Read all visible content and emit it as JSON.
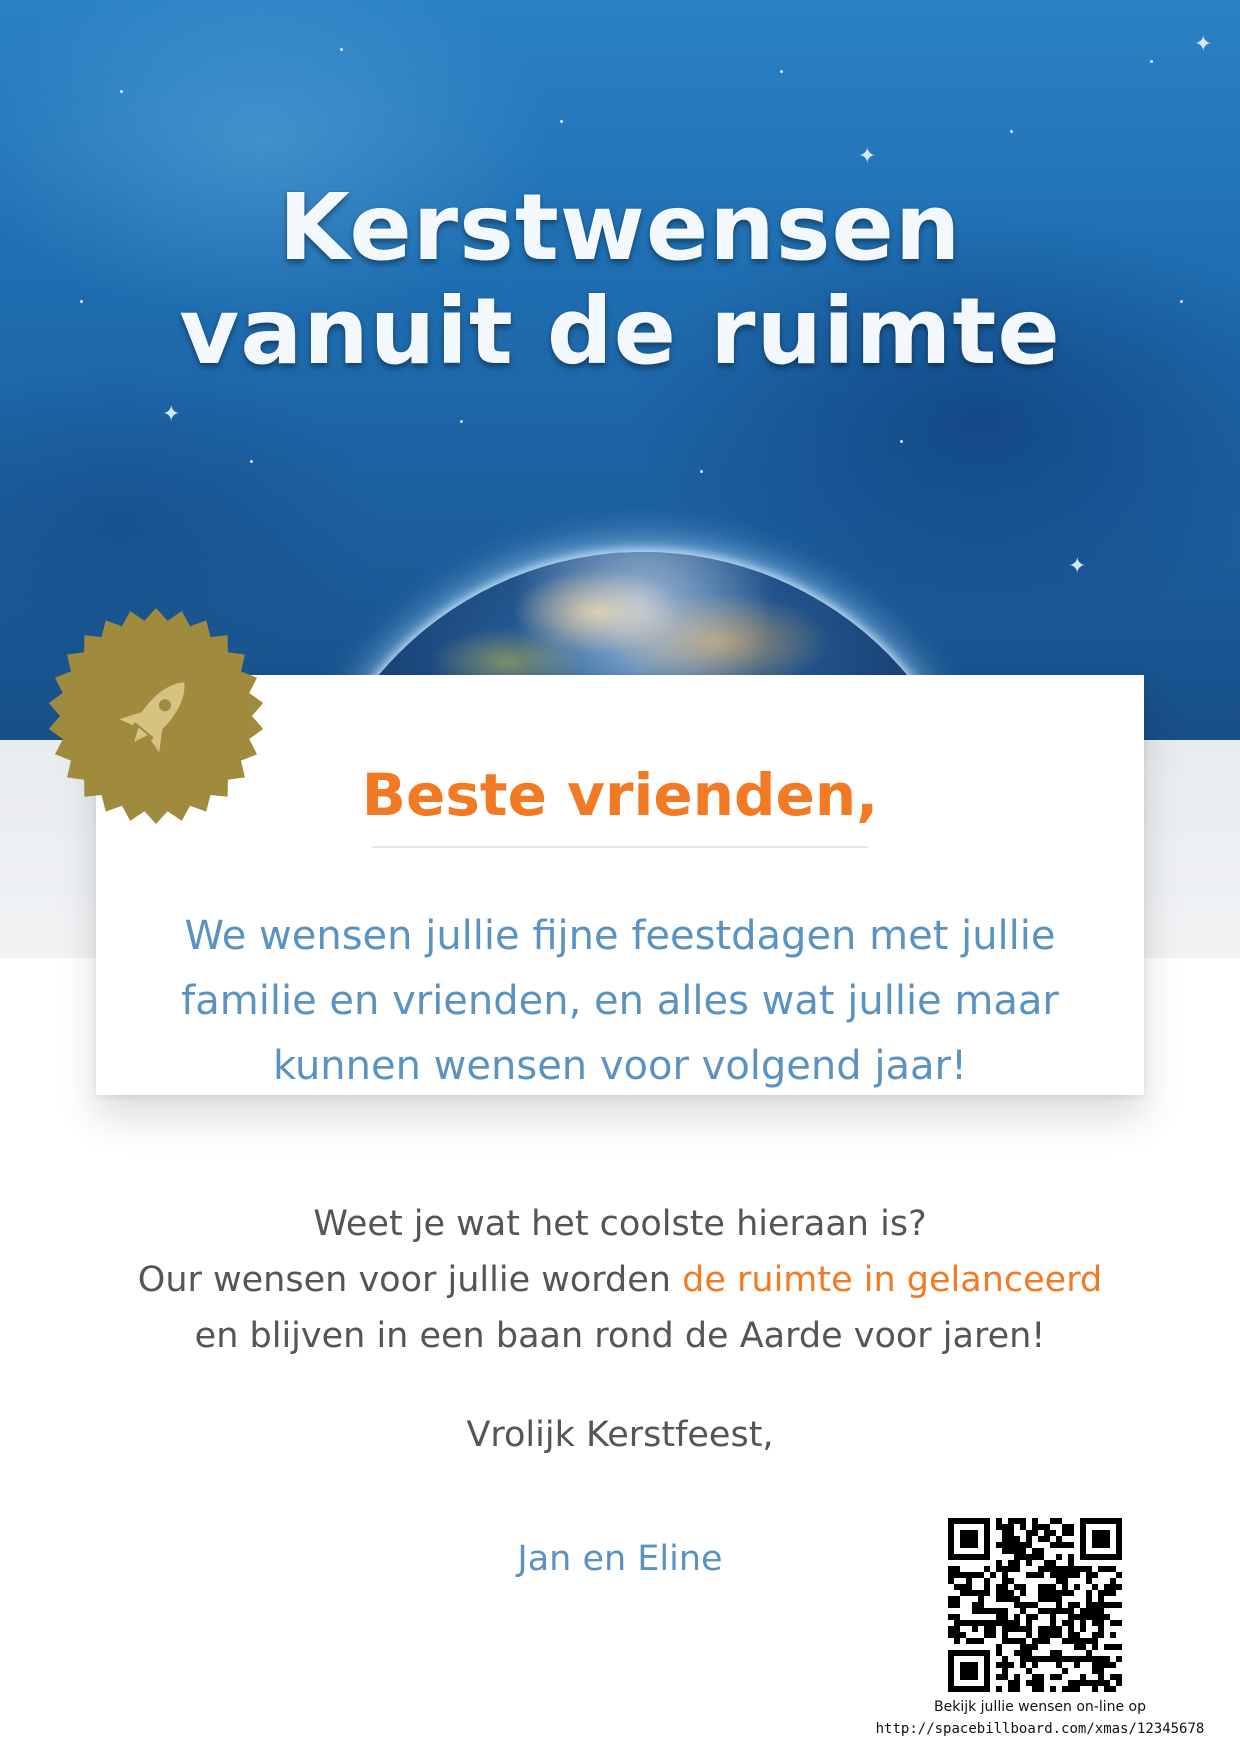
{
  "header": {
    "title_line_1": "Kerstwensen",
    "title_line_2": "vanuit de ruimte"
  },
  "badge": {
    "icon": "rocket-icon",
    "color": "#a08a3e"
  },
  "letter": {
    "greeting": "Beste vrienden,",
    "wish": "We wensen jullie fijne feestdagen met jullie familie en vrienden, en alles wat jullie maar kunnen wensen voor volgend jaar!",
    "question": "Weet je wat het coolste hieraan is?",
    "launch_prefix": "Our wensen voor jullie worden",
    "launch_highlight": "de ruimte in gelanceerd",
    "orbit": "en blijven in een baan rond de Aarde voor jaren!",
    "closing": "Vrolijk Kerstfeest,",
    "signature": "Jan en Eline"
  },
  "qr": {
    "caption": "Bekijk jullie wensen on-line op",
    "url": "http://spacebillboard.com/xmas/12345678"
  },
  "colors": {
    "accent_orange": "#f37a24",
    "accent_blue": "#5a93c2",
    "body_gray": "#555555"
  }
}
